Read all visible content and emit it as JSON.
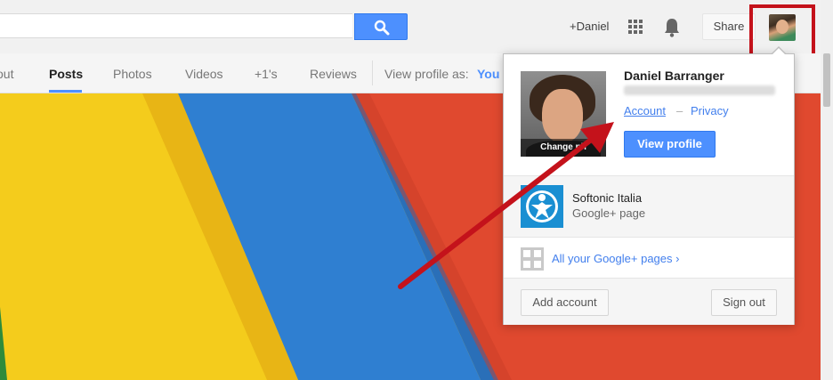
{
  "header": {
    "search": {
      "value": "",
      "placeholder": ""
    },
    "user_link": "+Daniel",
    "share_label": "Share"
  },
  "tabs": {
    "items": [
      {
        "label": "out"
      },
      {
        "label": "Posts"
      },
      {
        "label": "Photos"
      },
      {
        "label": "Videos"
      },
      {
        "label": "+1's"
      },
      {
        "label": "Reviews"
      }
    ],
    "active": "Posts",
    "view_profile_as_label": "View profile as:",
    "view_profile_as_value": "You"
  },
  "account_menu": {
    "name": "Daniel Barranger",
    "change_photo": "Change ph",
    "account_link": "Account",
    "separator": "–",
    "privacy_link": "Privacy",
    "view_profile": "View profile",
    "page": {
      "name": "Softonic Italia",
      "type": "Google+ page"
    },
    "all_pages": "All your Google+ pages ›",
    "add_account": "Add account",
    "sign_out": "Sign out"
  },
  "colors": {
    "accent": "#4d90fe",
    "highlight_box": "#c4121b",
    "arrow": "#c4121b",
    "cover_yellow": "#f4cc1c",
    "cover_blue": "#2f7fd1",
    "cover_red": "#e0492f",
    "cover_green": "#2e8b3b"
  },
  "icons": {
    "search": "search-icon",
    "apps": "apps-grid-icon",
    "notifications": "bell-icon",
    "pages": "pages-icon"
  }
}
